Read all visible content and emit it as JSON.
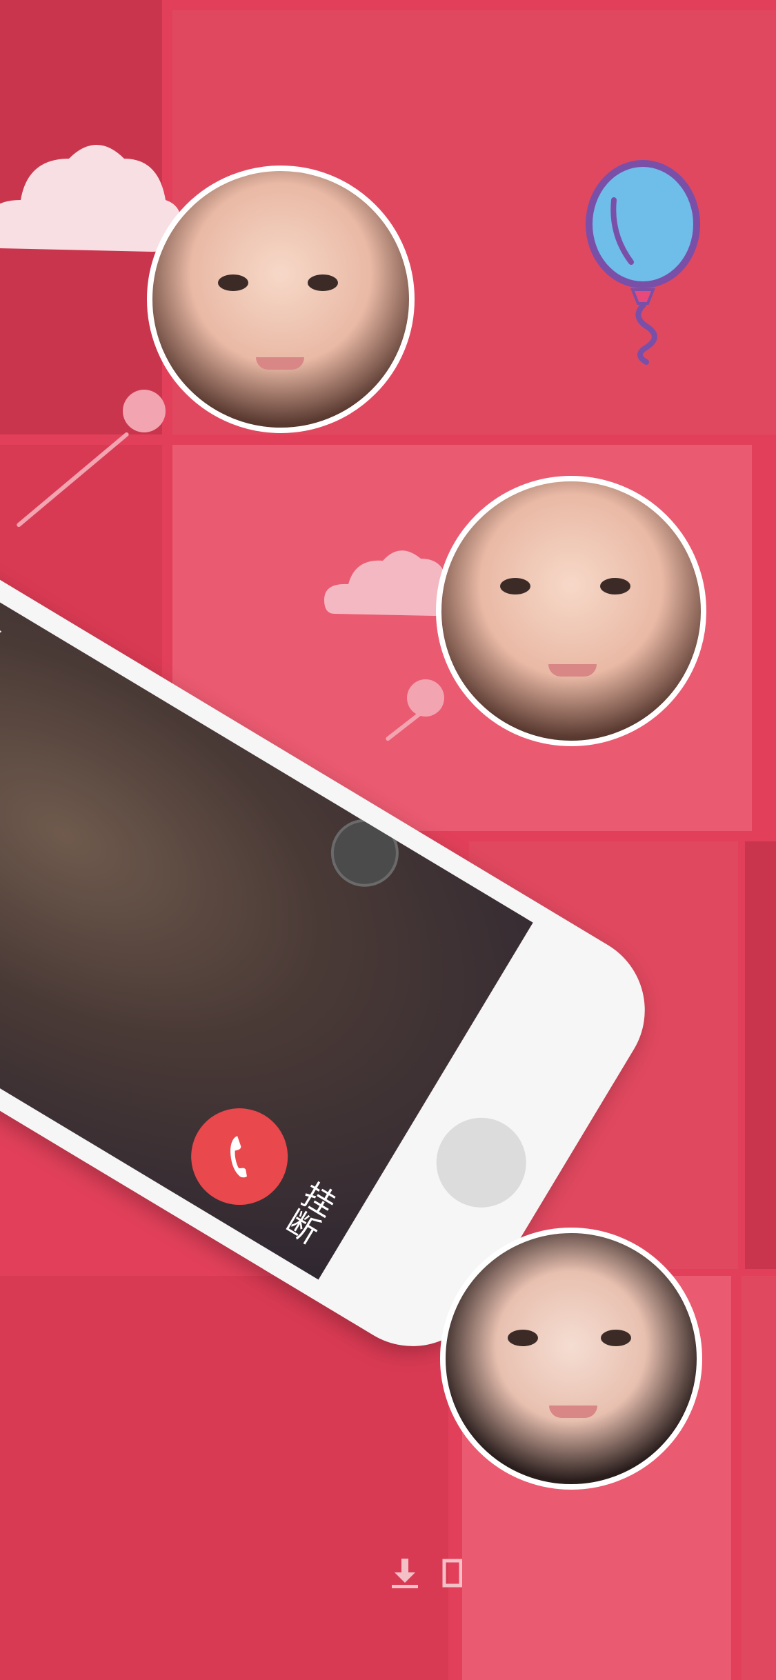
{
  "call": {
    "invite_text": "接受邀请.",
    "end_call_label": "挂断"
  },
  "icons": {
    "end_call": "phone-icon",
    "balloon": "balloon-icon",
    "download": "download-icon"
  },
  "colors": {
    "background": "#e2405a",
    "end_call": "#e9484d",
    "phone_body": "#f6f6f6",
    "connector": "#f3a4b1"
  }
}
